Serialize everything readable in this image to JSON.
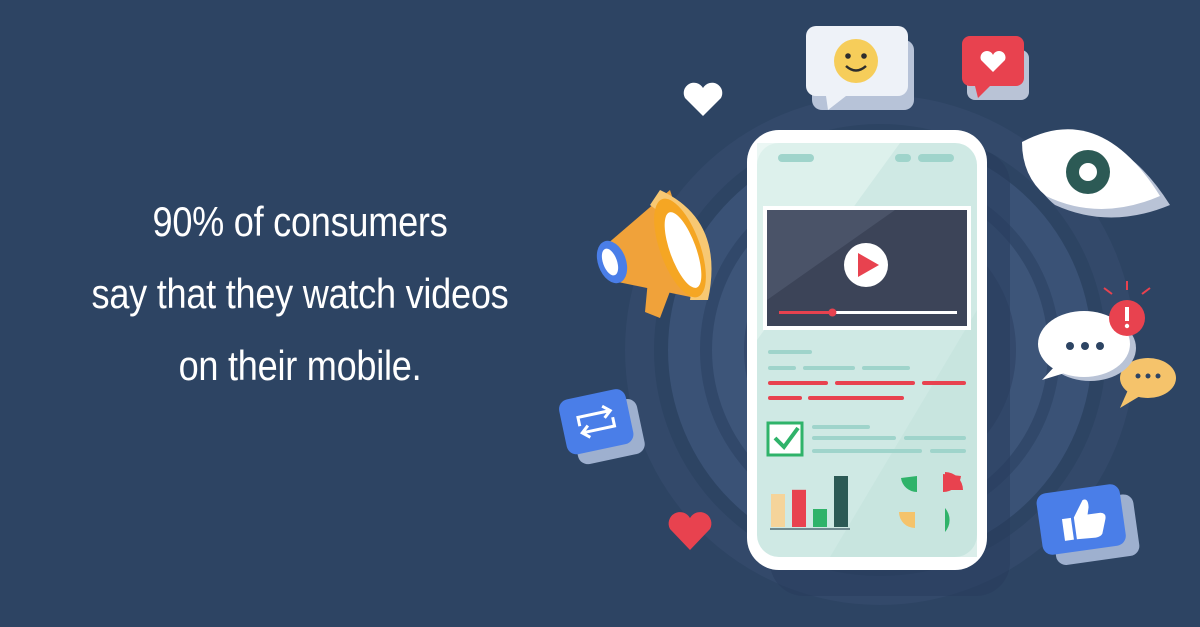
{
  "headline": {
    "line1": "90% of consumers",
    "line2": "say that they watch videos",
    "line3": "on their mobile."
  },
  "colors": {
    "background": "#2d4463",
    "accent_red": "#e8424f",
    "accent_yellow": "#f5a623",
    "accent_blue": "#4a7ee8",
    "accent_green": "#2fb36a",
    "screen": "#cfe9e4"
  },
  "video_player": {
    "progress": 0.3
  },
  "icons": [
    "smiley-bubble-icon",
    "heart-bubble-icon",
    "heart-icon",
    "eye-icon",
    "megaphone-icon",
    "chat-bubble-icon",
    "alert-icon",
    "repeat-icon",
    "thumbs-up-icon",
    "play-icon",
    "checkbox-icon"
  ],
  "bar_chart": {
    "values": [
      0.55,
      0.62,
      0.3,
      0.85
    ]
  }
}
